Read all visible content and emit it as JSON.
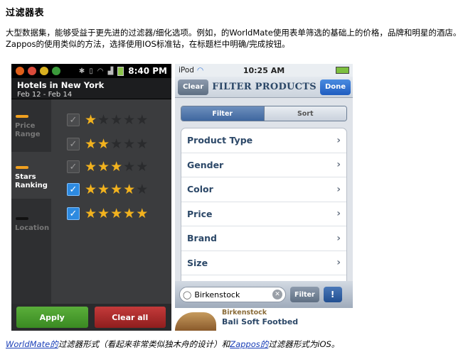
{
  "article": {
    "heading": "过滤器表",
    "intro": "大型数据集，能够受益于更先进的过滤器/细化选项。例如，的WorldMate使用表单筛选的基础上的价格，品牌和明星的酒店。 Zappos的使用类似的方法，选择使用IOS标准钻，在标题栏中明确/完成按钮。",
    "caption": {
      "link1": "WorldMate的",
      "text1": "过滤器形式（看起来非常类似独木舟的设计）和",
      "link2": "Zappos的",
      "text2": "过滤器形式为iOS。"
    }
  },
  "android": {
    "clock": "8:40 PM",
    "title": "Hotels in New York",
    "dates": "Feb 12 - Feb 14",
    "sidebar": [
      {
        "label": "Price\nRange",
        "bar_color": "#f0a020"
      },
      {
        "label": "Stars\nRanking",
        "bar_color": "#f0a020"
      },
      {
        "label": "Location",
        "bar_color": "#111111"
      }
    ],
    "ratings": [
      {
        "stars": 1,
        "checked": false
      },
      {
        "stars": 2,
        "checked": false
      },
      {
        "stars": 3,
        "checked": false
      },
      {
        "stars": 4,
        "checked": true
      },
      {
        "stars": 5,
        "checked": true
      }
    ],
    "apply_label": "Apply",
    "clear_label": "Clear all",
    "colors": {
      "checkbox_on": "#2d8ae0",
      "star": "#f2b21e",
      "apply": "#4a9c2e",
      "clear": "#aa2c2c"
    }
  },
  "ipod": {
    "carrier": "iPod",
    "clock": "10:25 AM",
    "clear_label": "Clear",
    "title": "FILTER PRODUCTS",
    "done_label": "Done",
    "segments": [
      "Filter",
      "Sort"
    ],
    "rows": [
      "Product Type",
      "Gender",
      "Color",
      "Price",
      "Brand",
      "Size"
    ],
    "search_value": "Birkenstock",
    "filter_label": "Filter",
    "alert_label": "!",
    "product": {
      "brand": "Birkenstock",
      "name": "Bali Soft Footbed"
    }
  }
}
